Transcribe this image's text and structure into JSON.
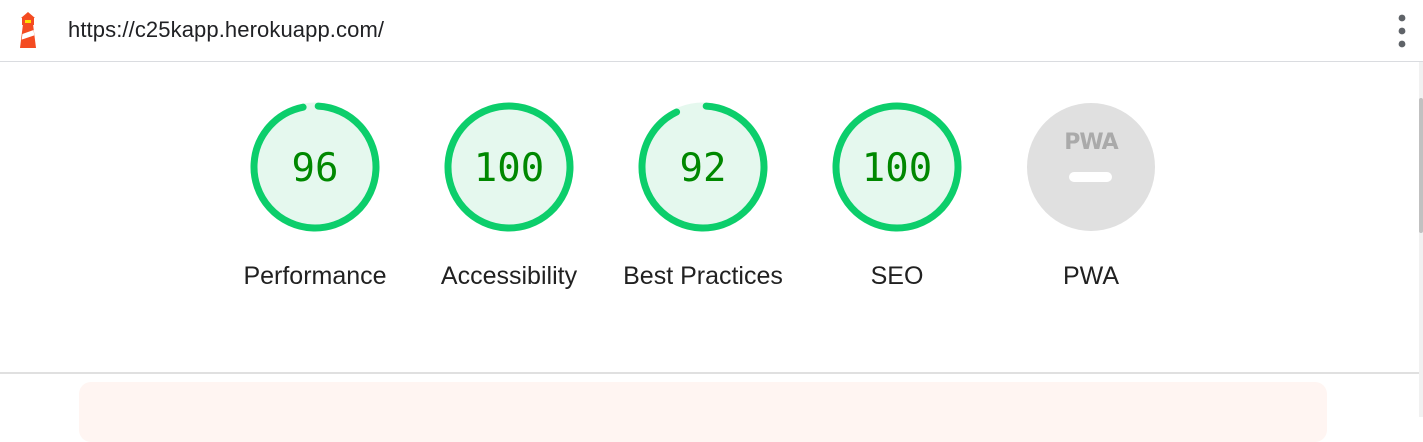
{
  "header": {
    "url": "https://c25kapp.herokuapp.com/",
    "logo_icon": "lighthouse-icon",
    "menu_icon": "more-vert-icon"
  },
  "colors": {
    "pass": "#0cce6b",
    "pass_fill": "#e5f8ee",
    "pass_text": "#008800",
    "track": "#e5f8ee",
    "pwa_bg": "#e0e0e0",
    "pwa_fg": "#aaaaaa",
    "warning_bg": "#fff5f2"
  },
  "gauges": [
    {
      "id": "performance",
      "score": 96,
      "label": "Performance"
    },
    {
      "id": "accessibility",
      "score": 100,
      "label": "Accessibility"
    },
    {
      "id": "best-practices",
      "score": 92,
      "label": "Best Practices"
    },
    {
      "id": "seo",
      "score": 100,
      "label": "SEO"
    }
  ],
  "pwa": {
    "badge_text": "PWA",
    "label": "PWA"
  }
}
